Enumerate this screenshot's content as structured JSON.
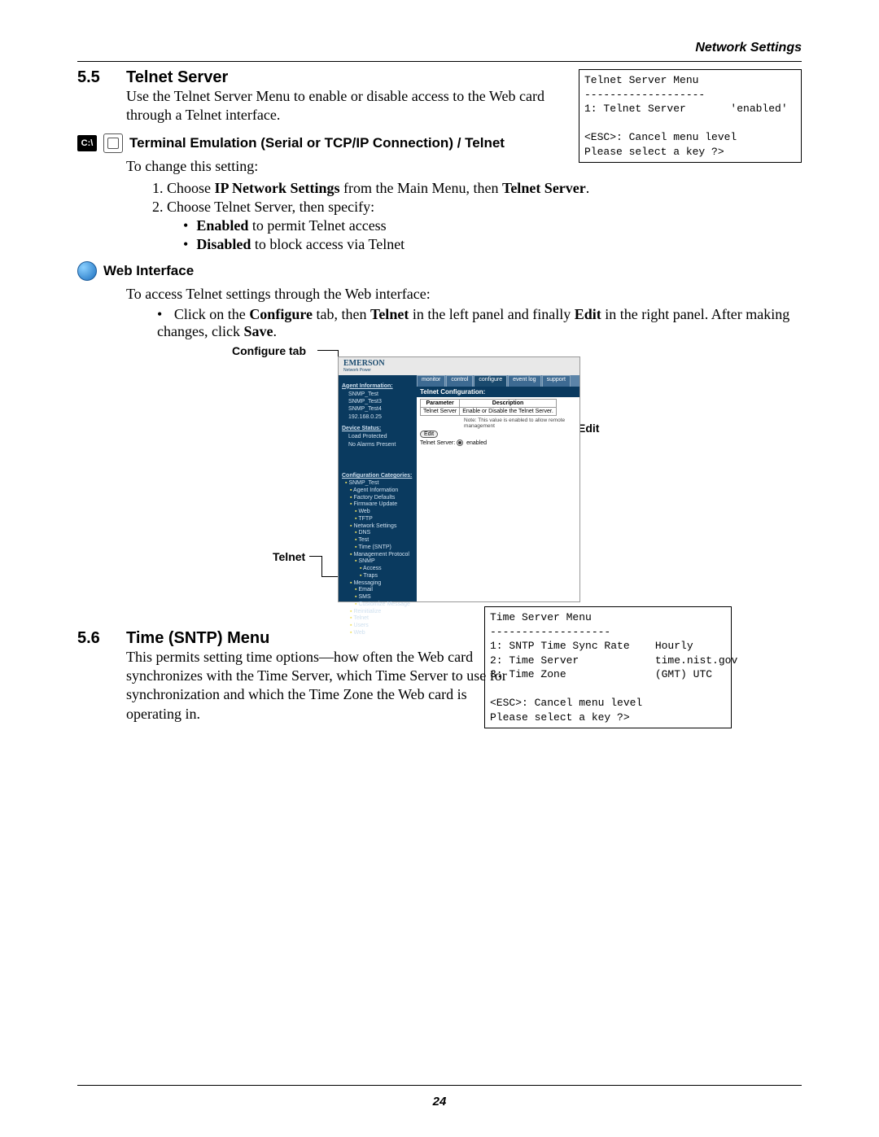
{
  "header": {
    "right": "Network Settings"
  },
  "sec55": {
    "num": "5.5",
    "title": "Telnet Server",
    "body": "Use the Telnet Server Menu to enable or disable access to the Web card through a Telnet interface."
  },
  "term1_lines": "Telnet Server Menu\n-------------------\n1: Telnet Server       'enabled'\n\n<ESC>: Cancel menu level\nPlease select a key ?>",
  "sub_term": {
    "title": "Terminal Emulation (Serial or TCP/IP Connection) / Telnet",
    "intro": "To change this setting:",
    "step1_a": "Choose ",
    "step1_b": "IP Network Settings",
    "step1_c": " from the Main Menu, then ",
    "step1_d": "Telnet Server",
    "step1_e": ".",
    "step2": "Choose Telnet Server, then specify:",
    "bullet1_a": "Enabled",
    "bullet1_b": " to permit Telnet access",
    "bullet2_a": "Disabled",
    "bullet2_b": " to block access via Telnet"
  },
  "sub_web": {
    "title": "Web Interface",
    "intro": "To access Telnet settings through the Web interface:",
    "bullet_a": "Click on the ",
    "bullet_b": "Configure",
    "bullet_c": " tab, then ",
    "bullet_d": "Telnet",
    "bullet_e": " in the left panel and finally ",
    "bullet_f": "Edit",
    "bullet_g": " in the right panel. After making changes, click ",
    "bullet_h": "Save",
    "bullet_i": "."
  },
  "figure": {
    "configure_label": "Configure tab",
    "edit_label": "Edit",
    "telnet_label": "Telnet",
    "logo": "EMERSON",
    "logo_sub": "Network Power",
    "tabs": [
      "monitor",
      "control",
      "configure",
      "event log",
      "support"
    ],
    "banner": "Telnet Configuration:",
    "th1": "Parameter",
    "th2": "Description",
    "td1": "Telnet Server",
    "td2": "Enable or Disable the Telnet Server.",
    "note": "Note: This value is enabled to allow remote management",
    "edit_btn": "Edit",
    "status_label": "Telnet Server:",
    "status_val": "enabled",
    "side_agent_hdr": "Agent Information:",
    "side_agent": [
      "SNMP_Test",
      "SNMP_Test3",
      "SNMP_Test4",
      "192.168.0.25"
    ],
    "side_dev_hdr": "Device Status:",
    "side_dev": [
      "Load Protected",
      "No Alarms Present"
    ],
    "side_cfg_hdr": "Configuration Categories:",
    "side_tree": [
      {
        "t": "SNMP_Test",
        "l": 0
      },
      {
        "t": "Agent Information",
        "l": 1
      },
      {
        "t": "Factory Defaults",
        "l": 1
      },
      {
        "t": "Firmware Update",
        "l": 1
      },
      {
        "t": "Web",
        "l": 2
      },
      {
        "t": "TFTP",
        "l": 2
      },
      {
        "t": "Network Settings",
        "l": 1
      },
      {
        "t": "DNS",
        "l": 2
      },
      {
        "t": "Test",
        "l": 2
      },
      {
        "t": "Time (SNTP)",
        "l": 2
      },
      {
        "t": "Management Protocol",
        "l": 1
      },
      {
        "t": "SNMP",
        "l": 2
      },
      {
        "t": "Access",
        "l": 3
      },
      {
        "t": "Traps",
        "l": 3
      },
      {
        "t": "Messaging",
        "l": 1
      },
      {
        "t": "Email",
        "l": 2
      },
      {
        "t": "SMS",
        "l": 2
      },
      {
        "t": "Customize Message",
        "l": 2
      },
      {
        "t": "Reinitialize",
        "l": 1
      },
      {
        "t": "Telnet",
        "l": 1
      },
      {
        "t": "Users",
        "l": 1
      },
      {
        "t": "Web",
        "l": 1
      }
    ]
  },
  "sec56": {
    "num": "5.6",
    "title": "Time (SNTP) Menu",
    "body": "This permits setting time options—how often the Web card synchronizes with the Time Server, which Time Server to use for synchronization and which the Time Zone the Web card is operating in."
  },
  "term2_lines": "Time Server Menu\n-------------------\n1: SNTP Time Sync Rate    Hourly\n2: Time Server            time.nist.gov\n3: Time Zone              (GMT) UTC\n\n<ESC>: Cancel menu level\nPlease select a key ?>",
  "footer": {
    "page": "24"
  },
  "icon": {
    "term_label": "C:\\"
  }
}
